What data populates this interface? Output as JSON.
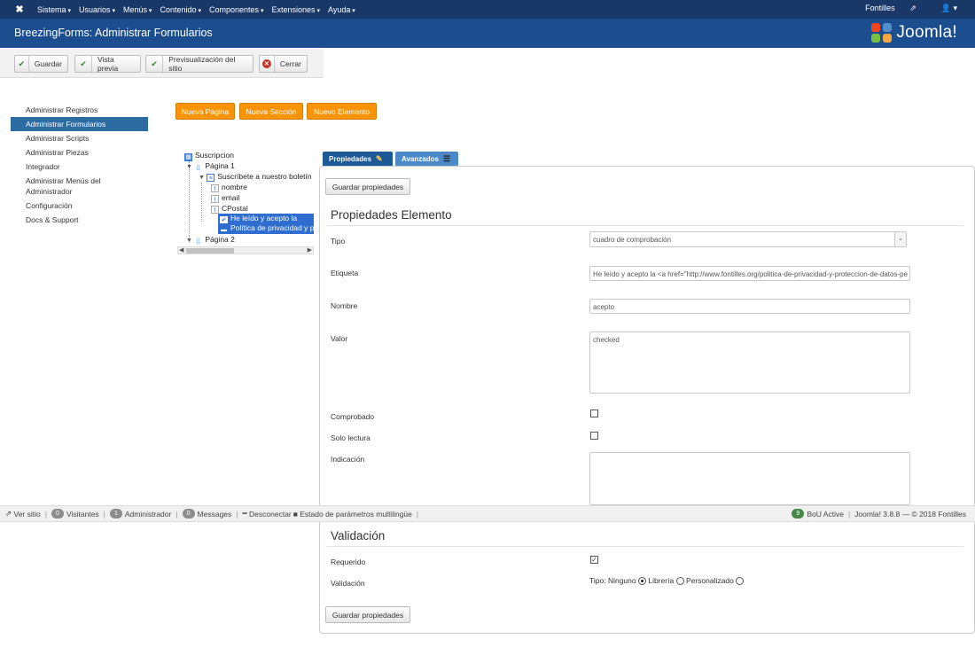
{
  "navbar": {
    "menu": [
      "Sistema",
      "Usuarios",
      "Menús",
      "Contenido",
      "Componentes",
      "Extensiones",
      "Ayuda"
    ],
    "user_site": "Fontilles",
    "user_icon": "user-icon"
  },
  "header": {
    "title": "BreezingForms: Administrar Formularios",
    "logo_text": "Joomla!"
  },
  "toolbar": {
    "save": "Guardar",
    "preview": "Vista previa",
    "site_preview": "Previsualización del sitio",
    "close": "Cerrar"
  },
  "sidebar": {
    "items": [
      "Administrar Registros",
      "Administrar Formularios",
      "Administrar Scripts",
      "Administrar Piezas",
      "Integrador",
      "Administrar Menús del Administrador",
      "Configuración",
      "Docs & Support"
    ]
  },
  "actions": {
    "new_page": "Nueva Página",
    "new_section": "Nueva Sección",
    "new_element": "Nuevo Elemento"
  },
  "tree": {
    "root": "Suscripcion",
    "page1": "Página 1",
    "section": "Suscríbete a nuestro boletín",
    "fields": [
      "nombre",
      "email",
      "CPostal"
    ],
    "selected": "He leído y acepto la",
    "privacy": "Política de privacidad y p",
    "page2": "Página 2"
  },
  "tabs": {
    "properties": "Propiedades",
    "advanced": "Avanzados"
  },
  "panel": {
    "save_props": "Guardar propiedades",
    "section_title": "Propiedades Elemento",
    "type_label": "Tipo",
    "type_value": "cuadro de comprobación",
    "label_label": "Etiqueta",
    "label_value": "He leído y acepto la <a href=\"http://www.fontilles.org/politica-de-privacidad-y-proteccion-de-datos-pe",
    "name_label": "Nombre",
    "name_value": "acepto",
    "value_label": "Valor",
    "value_value": "checked",
    "checked_label": "Comprobado",
    "readonly_label": "Solo lectura",
    "hint_label": "Indicación",
    "validation_title": "Validación",
    "required_label": "Requerido",
    "validation_label": "Validación",
    "validation_type_prefix": "Tipo: Ninguno",
    "validation_opt_library": "Librería",
    "validation_opt_custom": "Personalizado",
    "save_props_bottom": "Guardar propiedades"
  },
  "status": {
    "view_site": "Ver sitio",
    "visitors_count": "0",
    "visitors": "Visitantes",
    "admins_count": "1",
    "admins": "Administrador",
    "messages_count": "0",
    "messages": "Messages",
    "logout": "Desconectar",
    "multilang": "Estado de parámetros multilingüe",
    "bou": "BoU Active",
    "version": "Joomla! 3.8.8",
    "copyright": "— © 2018 Fontilles"
  }
}
